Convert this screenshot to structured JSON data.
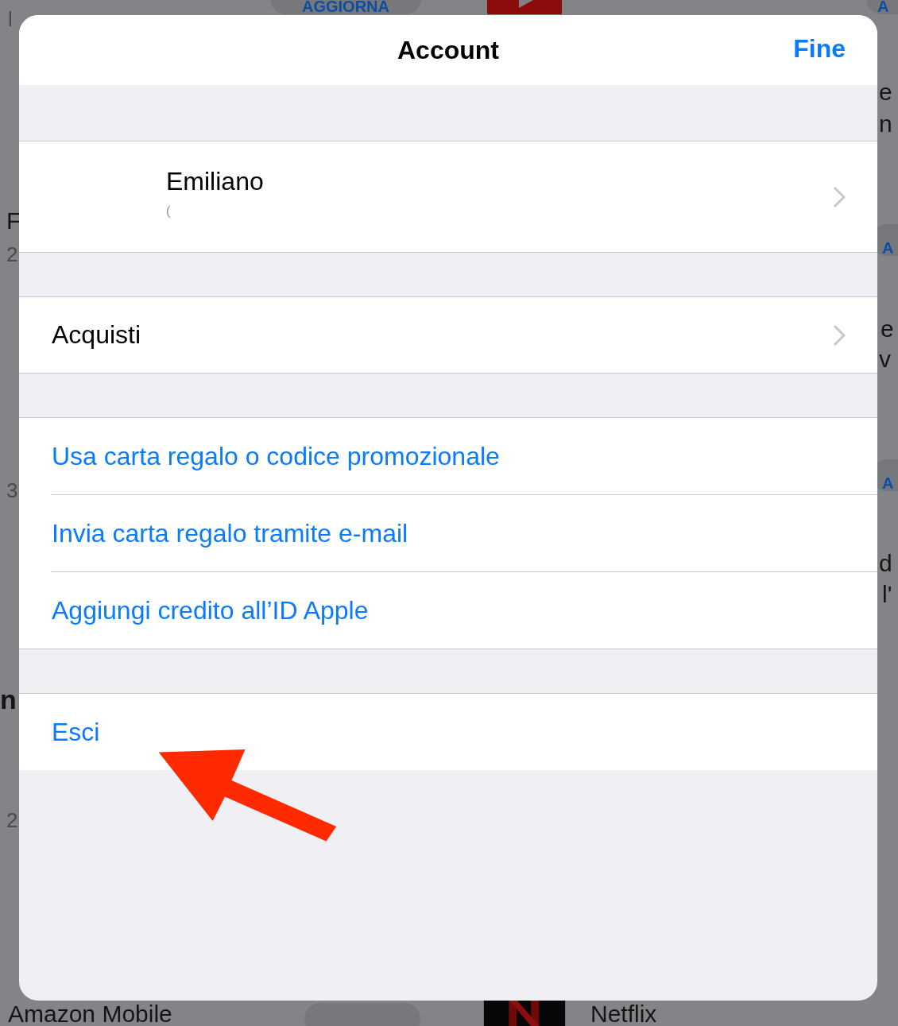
{
  "background": {
    "left_fragments": [
      "l",
      "F",
      "2",
      "3",
      "n",
      "2"
    ],
    "right_fragments": [
      "e",
      "n",
      "e",
      "v",
      "d",
      "l'"
    ],
    "buttons": [
      {
        "label": "AGGIORNA"
      },
      {
        "label": "A"
      },
      {
        "label": "A"
      },
      {
        "label": "A"
      }
    ],
    "app_names": [
      "Amazon Mobile",
      "Netflix"
    ]
  },
  "sheet": {
    "title": "Account",
    "done": "Fine",
    "profile": {
      "name": "Emiliano",
      "subtitle": "("
    },
    "purchases": "Acquisti",
    "gift_actions": [
      "Usa carta regalo o codice promozionale",
      "Invia carta regalo tramite e-mail",
      "Aggiungi credito all’ID Apple"
    ],
    "sign_out": "Esci"
  }
}
